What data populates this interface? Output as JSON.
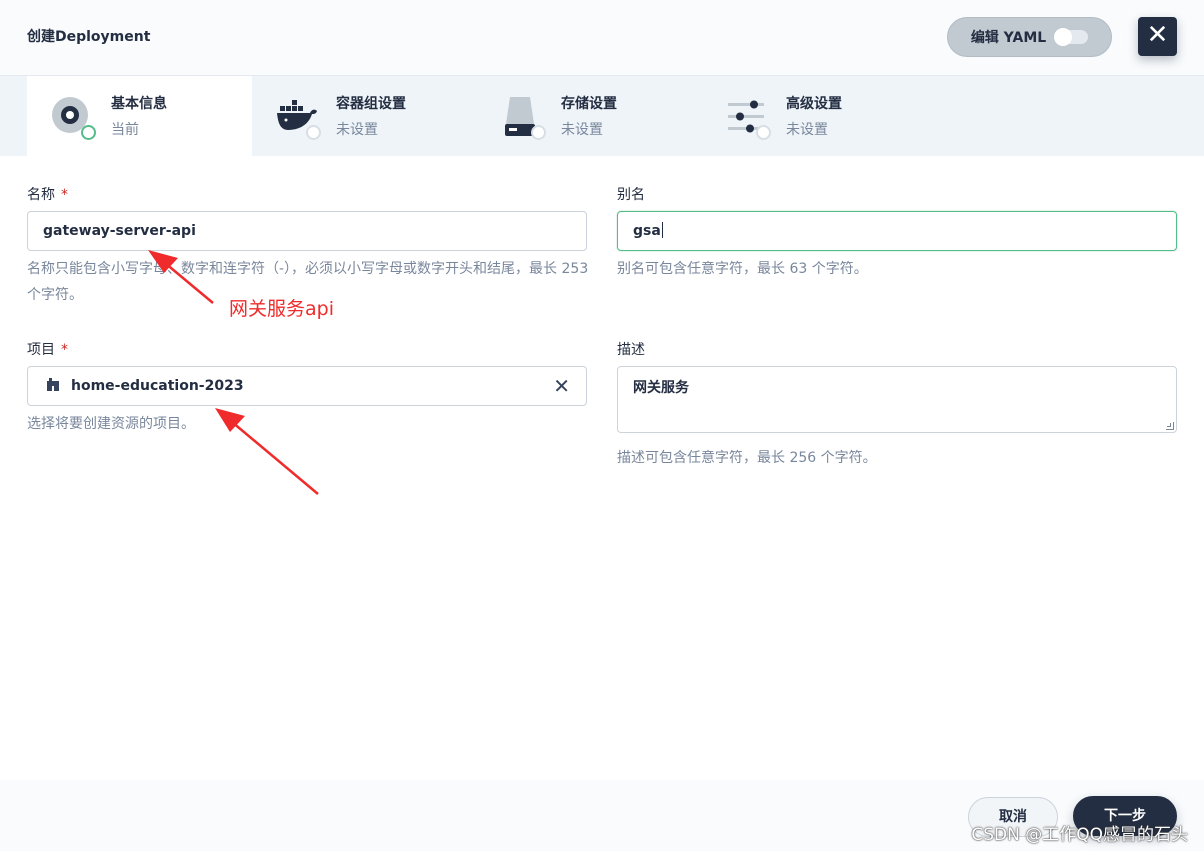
{
  "header": {
    "title": "创建Deployment",
    "yaml_label": "编辑 YAML",
    "close_icon": "close-icon"
  },
  "tabs": [
    {
      "title": "基本信息",
      "status": "当前",
      "icon": "disc-icon"
    },
    {
      "title": "容器组设置",
      "status": "未设置",
      "icon": "docker-whale-icon"
    },
    {
      "title": "存储设置",
      "status": "未设置",
      "icon": "storage-drive-icon"
    },
    {
      "title": "高级设置",
      "status": "未设置",
      "icon": "sliders-icon"
    }
  ],
  "form": {
    "name": {
      "label": "名称",
      "required_mark": "*",
      "value": "gateway-server-api",
      "hint": "名称只能包含小写字母、数字和连字符（-），必须以小写字母或数字开头和结尾，最长 253 个字符。"
    },
    "alias": {
      "label": "别名",
      "value": "gsa",
      "hint": "别名可包含任意字符，最长 63 个字符。"
    },
    "project": {
      "label": "项目",
      "required_mark": "*",
      "value": "home-education-2023",
      "hint": "选择将要创建资源的项目。"
    },
    "description": {
      "label": "描述",
      "value": "网关服务",
      "hint": "描述可包含任意字符，最长 256 个字符。"
    }
  },
  "annotation": {
    "text": "网关服务api",
    "color": "#ef2b2b"
  },
  "footer": {
    "cancel_label": "取消",
    "next_label": "下一步"
  },
  "watermark": "CSDN @工作QQ感冒的石头",
  "colors": {
    "accent_green": "#55bc8a",
    "dark": "#242e42",
    "muted": "#79879c"
  }
}
